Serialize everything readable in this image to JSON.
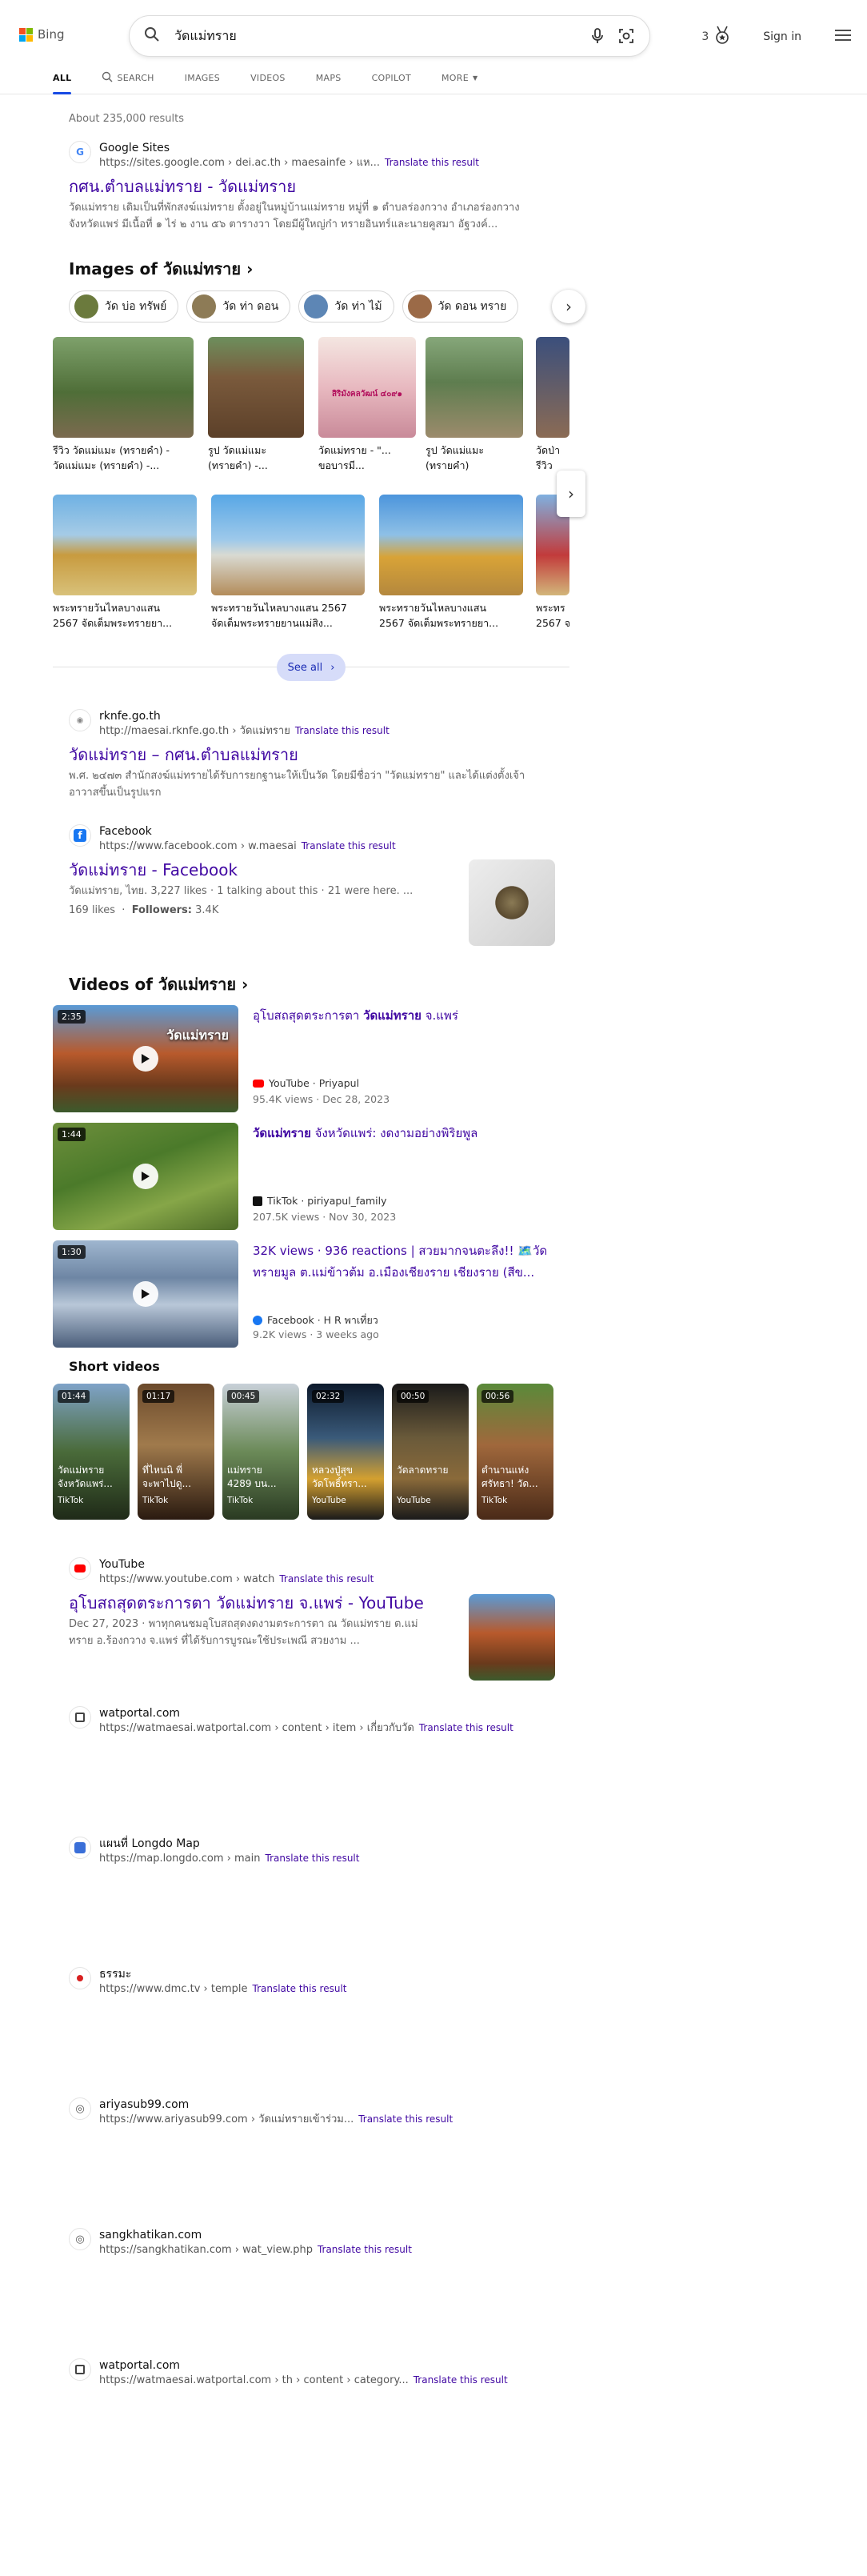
{
  "header": {
    "logo": "Bing",
    "query": "วัดแม่ทราย",
    "rewards_count": "3",
    "signin": "Sign in",
    "tabs": [
      "ALL",
      "SEARCH",
      "IMAGES",
      "VIDEOS",
      "MAPS",
      "COPILOT",
      "MORE"
    ]
  },
  "results_count": "About 235,000 results",
  "result1": {
    "source": "Google Sites",
    "url": "https://sites.google.com › dei.ac.th › maesainfe › แห...",
    "translate": "Translate this result",
    "title": "กศน.ตำบลแม่ทราย - วัดแม่ทราย",
    "snippet1": "วัดแม่ทราย เดิมเป็นที่พักสงฆ์แม่ทราย ตั้งอยู่ในหมู่บ้านแม่ทราย หมู่ที่ ๑ ตำบลร่องกวาง อำเภอร่องกวาง",
    "snippet2": "จังหวัดแพร่ มีเนื้อที่ ๑ ไร่ ๒ งาน ๕๖ ตารางวา โดยมีผู้ใหญ่ก๋า ทรายอินทร์และนายคูสมา อัฐวงค์..."
  },
  "images": {
    "heading": "Images of วัดแม่ทราย",
    "pills": [
      "วัด บ่อ ทรัพย์",
      "วัด ท่า ดอน",
      "วัด ท่า ไม้",
      "วัด ดอน ทราย"
    ],
    "row1": [
      {
        "cap1": "รีวิว วัดแม่แมะ (ทรายคำ) -",
        "cap2": "วัดแม่แมะ (ทรายคำ) -..."
      },
      {
        "cap1": "รูป วัดแม่แมะ",
        "cap2": "(ทรายคำ) -..."
      },
      {
        "cap1": "วัดแม่ทราย - \"...",
        "cap2": "ขอบารมี..."
      },
      {
        "cap1": "รูป วัดแม่แมะ",
        "cap2": "(ทรายคำ)"
      },
      {
        "cap1": "วัดป่า",
        "cap2": "รีวิว"
      }
    ],
    "row1_overlay": "สิริมังคลวัฒน์ ๔๐๙๑",
    "row2": [
      {
        "cap1": "พระทรายวันไหลบางแสน",
        "cap2": "2567 จัดเต็มพระทรายยา..."
      },
      {
        "cap1": "พระทรายวันไหลบางแสน 2567",
        "cap2": "จัดเต็มพระทรายยานแม่สิง..."
      },
      {
        "cap1": "พระทรายวันไหลบางแสน",
        "cap2": "2567 จัดเต็มพระทรายยา..."
      },
      {
        "cap1": "พระทร",
        "cap2": "2567 จ"
      }
    ],
    "see_all": "See all"
  },
  "result2": {
    "source": "rknfe.go.th",
    "url": "http://maesai.rknfe.go.th › วัดแม่ทราย",
    "translate": "Translate this result",
    "title": "วัดแม่ทราย – กศน.ตำบลแม่ทราย",
    "snippet1": "พ.ศ. ๒๔๗๓ สำนักสงฆ์แม่ทรายได้รับการยกฐานะให้เป็นวัด โดยมีชื่อว่า \"วัดแม่ทราย\" และได้แต่งตั้งเจ้า",
    "snippet2": "อาวาสขึ้นเป็นรูปแรก"
  },
  "result3": {
    "source": "Facebook",
    "url": "https://www.facebook.com › w.maesai",
    "translate": "Translate this result",
    "title": "วัดแม่ทราย - Facebook",
    "snippet": "วัดแม่ทราย, ไทย. 3,227 likes · 1 talking about this · 21 were here. ...",
    "likes": "169 likes",
    "followers_label": "Followers:",
    "followers": "3.4K"
  },
  "videos": {
    "heading": "Videos of วัดแม่ทราย",
    "items": [
      {
        "duration": "2:35",
        "title_pre": "อุโบสถสุดตระการตา ",
        "title_bold": "วัดแม่ทราย",
        "title_post": " จ.แพร่",
        "line2": "",
        "source": "YouTube · Priyapul",
        "meta": "95.4K views · Dec 28, 2023",
        "overlay": "วัดแม่ทราย"
      },
      {
        "duration": "1:44",
        "title_pre": "",
        "title_bold": "วัดแม่ทราย",
        "title_post": " จังหวัดแพร่: งดงามอย่างพิริยพูล",
        "line2": "",
        "source": "TikTok · piriyapul_family",
        "meta": "207.5K views · Nov 30, 2023",
        "overlay": ""
      },
      {
        "duration": "1:30",
        "title_pre": "32K views · 936 reactions | สวยมากจนตะลึง!! 🗺️วัด",
        "title_bold": "",
        "title_post": "",
        "line2": "ทรายมูล ต.แม่ข้าวต้ม อ.เมืองเชียงราย เชียงราย (สีข...",
        "source": "Facebook · H R พาเที่ยว",
        "meta": "9.2K views · 3 weeks ago",
        "overlay": ""
      }
    ]
  },
  "shorts": {
    "heading": "Short videos",
    "items": [
      {
        "duration": "01:44",
        "t1": "วัดแม่ทราย",
        "t2": "จังหวัดแพร่...",
        "src": "TikTok"
      },
      {
        "duration": "01:17",
        "t1": "ที่ไหนนิ พี่",
        "t2": "จะพาไปดู...",
        "src": "TikTok"
      },
      {
        "duration": "00:45",
        "t1": "แม่ทราย",
        "t2": "4289 บน...",
        "src": "TikTok"
      },
      {
        "duration": "02:32",
        "t1": "หลวงปู่สุข",
        "t2": "วัดโพธิ์ทรา...",
        "src": "YouTube"
      },
      {
        "duration": "00:50",
        "t1": "วัดลาดทราย",
        "t2": "",
        "src": "YouTube"
      },
      {
        "duration": "00:56",
        "t1": "ตำนานแห่ง",
        "t2": "ศรัทธา! วัด...",
        "src": "TikTok"
      }
    ]
  },
  "result4": {
    "source": "YouTube",
    "url": "https://www.youtube.com › watch",
    "translate": "Translate this result",
    "title": "อุโบสถสุดตระการตา วัดแม่ทราย จ.แพร่ - YouTube",
    "snippet1": "Dec 27, 2023 · พาทุกคนชมอุโบสถสุดงดงามตระการตา ณ วัดแม่ทราย ต.แม่",
    "snippet2": "ทราย อ.ร้องกวาง จ.แพร่ ที่ได้รับการบูรณะใช้ประเพณี สวยงาม ..."
  },
  "simple_results": [
    {
      "source": "watportal.com",
      "url": "https://watmaesai.watportal.com › content › item › เกี่ยวกับวัด",
      "translate": "Translate this result"
    },
    {
      "source": "แผนที่ Longdo Map",
      "url": "https://map.longdo.com › main",
      "translate": "Translate this result"
    },
    {
      "source": "ธรรมะ",
      "url": "https://www.dmc.tv › temple",
      "translate": "Translate this result"
    },
    {
      "source": "ariyasub99.com",
      "url": "https://www.ariyasub99.com › วัดแม่ทรายเข้าร่วม...",
      "translate": "Translate this result"
    },
    {
      "source": "sangkhatikan.com",
      "url": "https://sangkhatikan.com › wat_view.php",
      "translate": "Translate this result"
    },
    {
      "source": "watportal.com",
      "url": "https://watmaesai.watportal.com › th › content › category...",
      "translate": "Translate this result"
    }
  ],
  "colors": {
    "link": "#4007a2",
    "accent": "#174ae4",
    "ms_red": "#f25022",
    "ms_green": "#7fba00",
    "ms_blue": "#00a4ef",
    "ms_yellow": "#ffb900"
  }
}
